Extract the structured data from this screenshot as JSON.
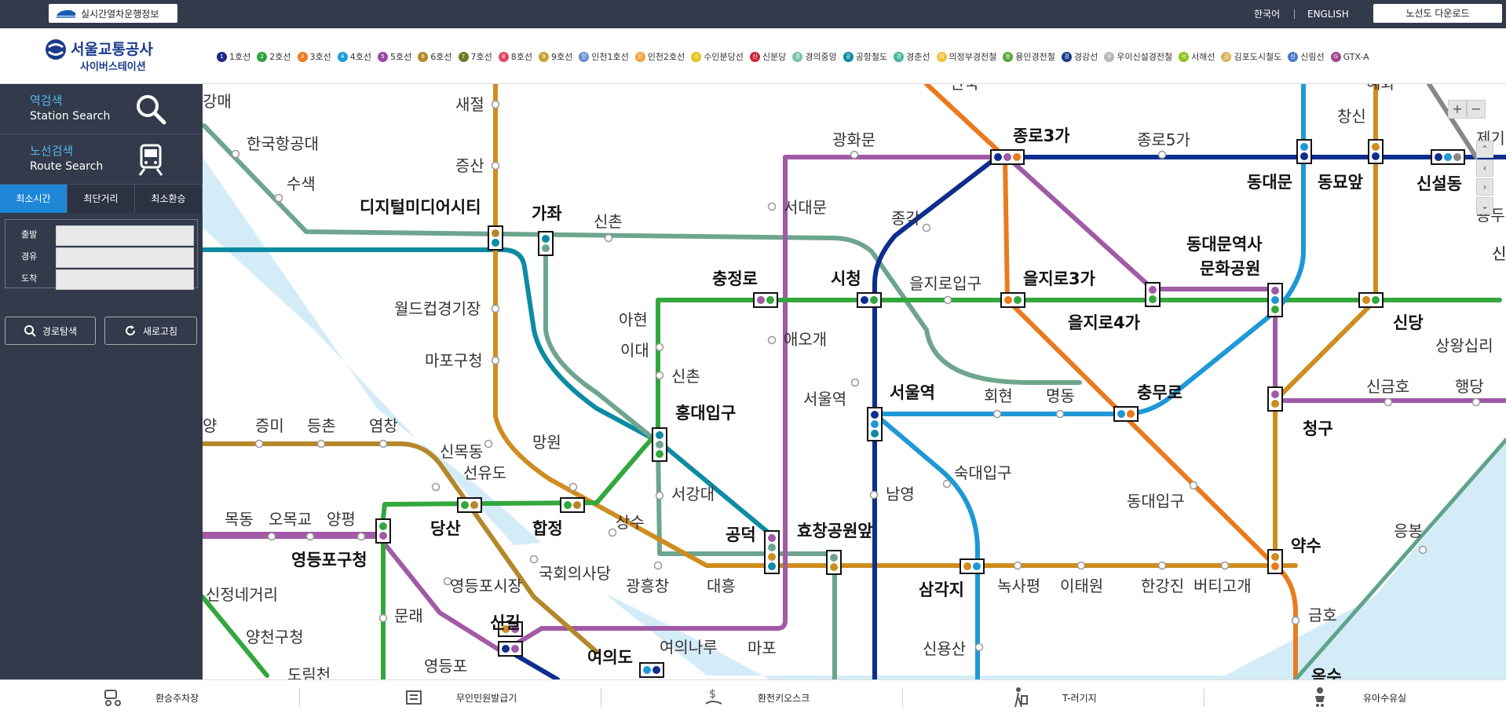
{
  "topbar": {
    "realtime_label": "실시간열차운행정보",
    "lang_ko": "한국어",
    "lang_en": "ENGLISH",
    "download_label": "노선도 다운로드"
  },
  "logo": {
    "title": "서울교통공사",
    "subtitle": "사이버스테이션"
  },
  "legend": [
    {
      "num": "1",
      "label": "1호선",
      "color": "#1d2a8a"
    },
    {
      "num": "2",
      "label": "2호선",
      "color": "#33a23d"
    },
    {
      "num": "3",
      "label": "3호선",
      "color": "#ee7d1f"
    },
    {
      "num": "4",
      "label": "4호선",
      "color": "#1e9ed6"
    },
    {
      "num": "5",
      "label": "5호선",
      "color": "#9b4aa3"
    },
    {
      "num": "6",
      "label": "6호선",
      "color": "#b4892c"
    },
    {
      "num": "7",
      "label": "7호선",
      "color": "#6d7a24"
    },
    {
      "num": "8",
      "label": "8호선",
      "color": "#e6466b"
    },
    {
      "num": "9",
      "label": "9호선",
      "color": "#c8a433"
    },
    {
      "num": "인",
      "label": "인천1호선",
      "color": "#6d8fd6"
    },
    {
      "num": "인",
      "label": "인천2호선",
      "color": "#f2a33a"
    },
    {
      "num": "수",
      "label": "수인분당선",
      "color": "#e5c21c"
    },
    {
      "num": "신",
      "label": "신분당",
      "color": "#c92835"
    },
    {
      "num": "경",
      "label": "경의중앙",
      "color": "#77c4a3"
    },
    {
      "num": "공",
      "label": "공항철도",
      "color": "#0a8aa6"
    },
    {
      "num": "경",
      "label": "경춘선",
      "color": "#42b99b"
    },
    {
      "num": "의",
      "label": "의정부경전철",
      "color": "#f1c13b"
    },
    {
      "num": "용",
      "label": "용인경전철",
      "color": "#56a837"
    },
    {
      "num": "경",
      "label": "경강선",
      "color": "#1b3a8a"
    },
    {
      "num": "우",
      "label": "우이신설경전철",
      "color": "#b7b7b7"
    },
    {
      "num": "서",
      "label": "서해선",
      "color": "#8fc31f"
    },
    {
      "num": "김",
      "label": "김포도시철도",
      "color": "#d8b45a"
    },
    {
      "num": "신",
      "label": "신림선",
      "color": "#4c7ac9"
    },
    {
      "num": "G",
      "label": "GTX-A",
      "color": "#9e4a8e"
    }
  ],
  "sidebar": {
    "station_search_ko": "역검색",
    "station_search_en": "Station Search",
    "route_search_ko": "노선검색",
    "route_search_en": "Route Search",
    "tabs": [
      "최소시간",
      "최단거리",
      "최소환승"
    ],
    "depart": "출발",
    "via": "경유",
    "arrive": "도착",
    "search_btn": "경로탐색",
    "refresh_btn": "새로고침"
  },
  "map": {
    "zoom_in": "+",
    "zoom_out": "−",
    "stations": {
      "s01": "강매",
      "s02": "한국항공대",
      "s03": "수색",
      "s04": "새절",
      "s05": "증산",
      "s06": "디지털미디어시티",
      "s07": "가좌",
      "s08": "신촌",
      "s09": "월드컵경기장",
      "s10": "마포구청",
      "s11": "광화문",
      "s12": "서대문",
      "s13": "종로3가",
      "s14": "종로5가",
      "s15": "종각",
      "s16": "동대문",
      "s17": "동묘앞",
      "s18": "신설동",
      "s19": "창신",
      "s20": "동대문역사",
      "s21": "문화공원",
      "s22": "충정로",
      "s23": "시청",
      "s24": "을지로입구",
      "s25": "을지로3가",
      "s26": "을지로4가",
      "s27": "아현",
      "s28": "이대",
      "s29": "신촌",
      "s30": "애오개",
      "s31": "서울역",
      "s32": "서울역",
      "s33": "회현",
      "s34": "명동",
      "s35": "충무로",
      "s36": "신당",
      "s37": "상왕십리",
      "s38": "신금호",
      "s39": "행당",
      "s40": "청구",
      "s41": "홍대입구",
      "s42": "망원",
      "s43": "신목동",
      "s44": "선유도",
      "s45": "증미",
      "s46": "등촌",
      "s47": "염창",
      "s48": "숙대입구",
      "s49": "남영",
      "s50": "동대입구",
      "s51": "서강대",
      "s52": "당산",
      "s53": "합정",
      "s54": "상수",
      "s55": "공덕",
      "s56": "효창공원앞",
      "s57": "삼각지",
      "s58": "녹사평",
      "s59": "이태원",
      "s60": "한강진",
      "s61": "버티고개",
      "s62": "약수",
      "s63": "응봉",
      "s64": "목동",
      "s65": "오목교",
      "s66": "양평",
      "s67": "영등포구청",
      "s68": "국회의사당",
      "s69": "영등포시장",
      "s70": "광흥창",
      "s71": "대흥",
      "s72": "문래",
      "s73": "신길",
      "s74": "여의도",
      "s75": "여의나루",
      "s76": "마포",
      "s77": "신정네거리",
      "s78": "양천구청",
      "s79": "도림천",
      "s80": "영등포",
      "s81": "신용산",
      "s82": "금호",
      "s83": "옥수",
      "s84": "안국",
      "s85": "혜화",
      "s86": "제기",
      "s87": "용두",
      "s88": "신답",
      "s89": "양",
      "s90": "신"
    }
  },
  "footer": {
    "items": [
      "환승주차장",
      "무인민원발급기",
      "환전키오스크",
      "T-러기지",
      "유아수유실"
    ]
  }
}
